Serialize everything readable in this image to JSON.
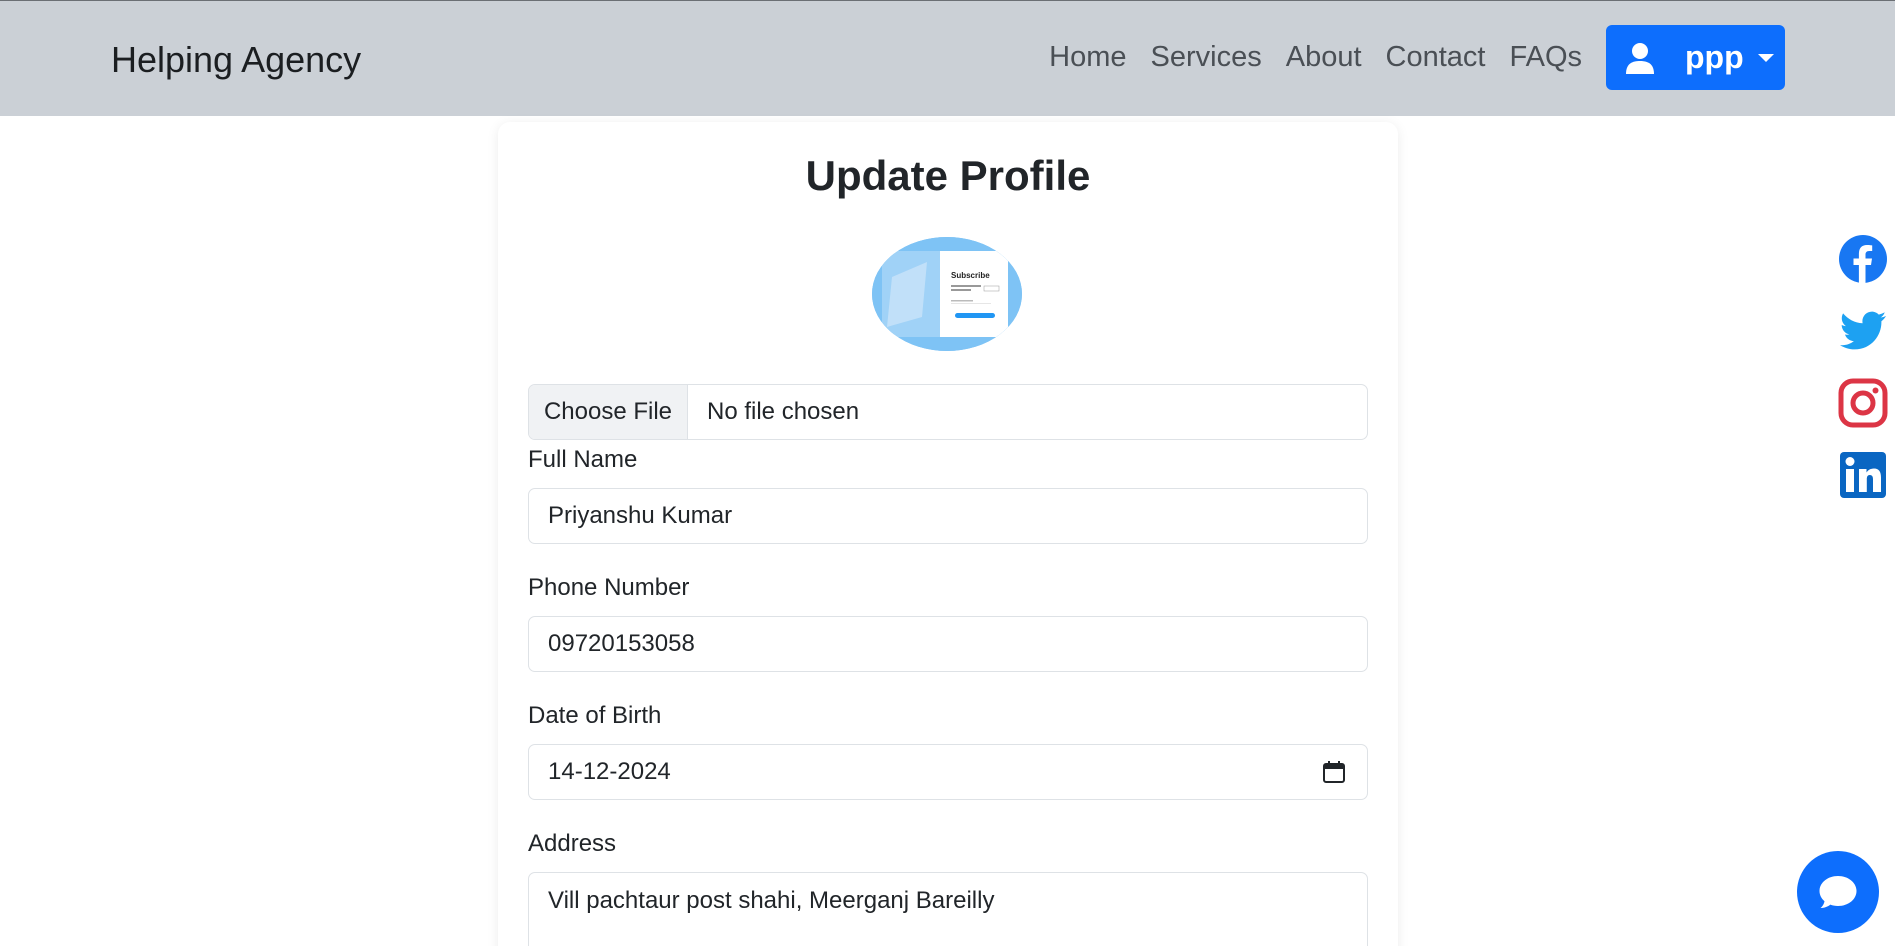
{
  "navbar": {
    "brand": "Helping Agency",
    "links": [
      "Home",
      "Services",
      "About",
      "Contact",
      "FAQs"
    ],
    "user": {
      "name": "ppp"
    }
  },
  "form": {
    "title": "Update Profile",
    "avatar_image_text": {
      "title": "Subscribe"
    },
    "file": {
      "button": "Choose File",
      "status": "No file chosen"
    },
    "fields": {
      "full_name": {
        "label": "Full Name",
        "value": "Priyanshu Kumar"
      },
      "phone": {
        "label": "Phone Number",
        "value": "09720153058"
      },
      "dob": {
        "label": "Date of Birth",
        "value": "14-12-2024"
      },
      "address": {
        "label": "Address",
        "value": "Vill pachtaur post shahi, Meerganj Bareilly"
      }
    }
  },
  "social": [
    "facebook-icon",
    "twitter-icon",
    "instagram-icon",
    "linkedin-icon"
  ],
  "colors": {
    "navbar_bg": "#cbd0d6",
    "primary": "#0d6efd",
    "facebook": "#1877f2",
    "twitter": "#1da1f2",
    "instagram": "#dc3545",
    "linkedin": "#0a66c2"
  }
}
